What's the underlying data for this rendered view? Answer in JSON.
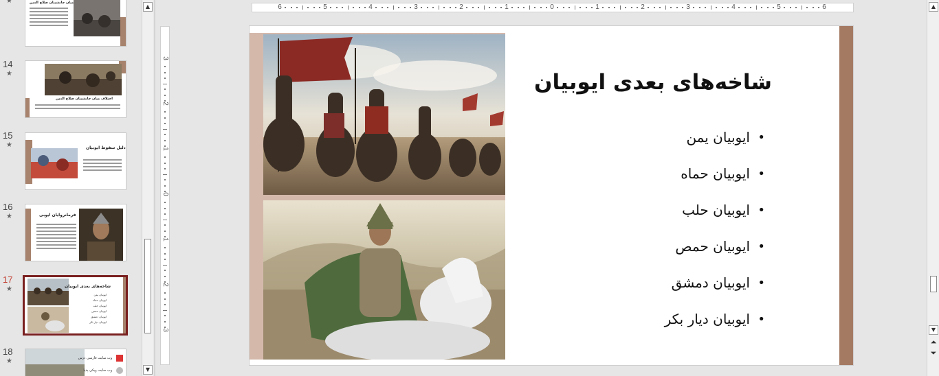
{
  "thumbnails": [
    {
      "number": "",
      "title": "اختلاف میان جانشینان صلاح الدین"
    },
    {
      "number": "14",
      "title": "اختلاف میان جانشینان صلاح الدین"
    },
    {
      "number": "15",
      "title": "دلیل سقوط ایوبیان"
    },
    {
      "number": "16",
      "title": "فرمانروایان ایوبی"
    },
    {
      "number": "17",
      "title": "شاخه‌های بعدی ایوبیان",
      "bullets": [
        "ایوبیان یمن",
        "ایوبیان حماه",
        "ایوبیان حلب",
        "ایوبیان حمص",
        "ایوبیان دمشق",
        "ایوبیان دیار بکر"
      ]
    },
    {
      "number": "18",
      "title": "وب سایت فارسی درس",
      "subtitle": "وب سایت ویکی پدیا"
    }
  ],
  "star_glyph": "★",
  "ruler": {
    "horizontal_labels": [
      "6",
      "5",
      "4",
      "3",
      "2",
      "1",
      "0",
      "1",
      "2",
      "3",
      "4",
      "5",
      "6"
    ],
    "vertical_labels": [
      "3",
      "2",
      "1",
      "0",
      "1",
      "2",
      "3"
    ]
  },
  "slide": {
    "title": "شاخه‌های بعدی ایوبیان",
    "bullets": [
      "ایوبیان یمن",
      "ایوبیان حماه",
      "ایوبیان حلب",
      "ایوبیان حمص",
      "ایوبیان دمشق",
      "ایوبیان دیار بکر"
    ],
    "photos": [
      "cavalry-army-image",
      "mounted-warrior-image"
    ]
  },
  "colors": {
    "accent_brown": "#a47a63",
    "strip_tan": "#d4b9ab",
    "active_thumb_border": "#7a1f1f",
    "active_number": "#c0392b"
  },
  "scroll": {
    "up_glyph": "▲",
    "down_glyph": "▼",
    "prev_glyph": "⏶",
    "next_glyph": "⏷"
  }
}
